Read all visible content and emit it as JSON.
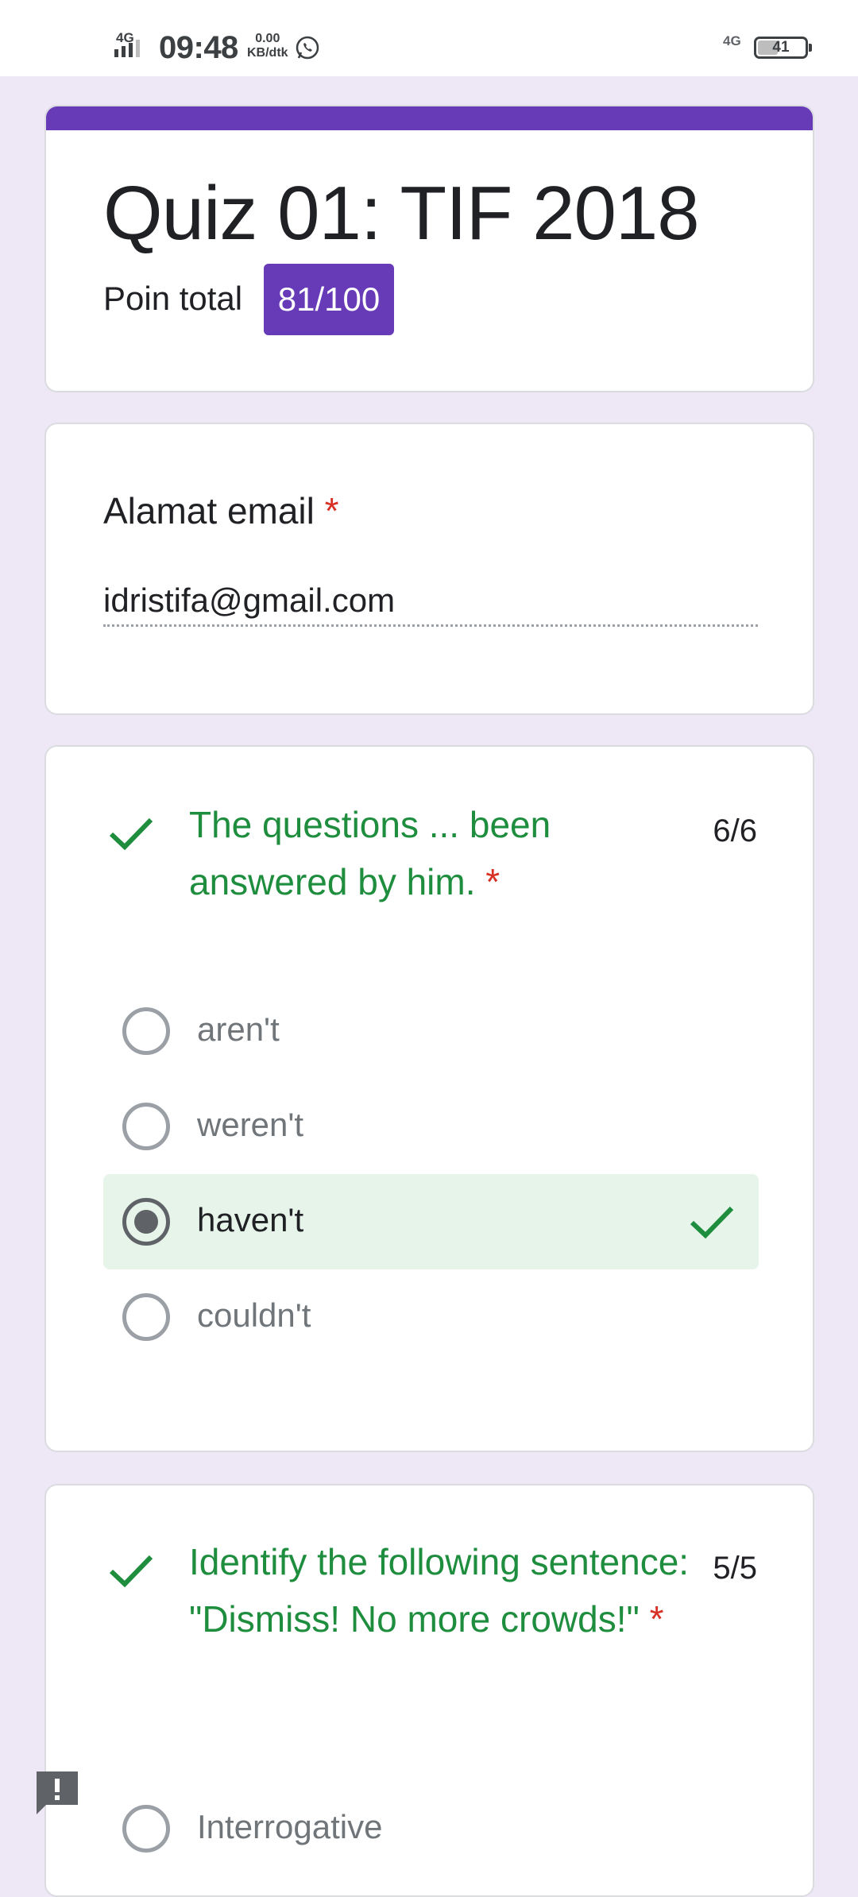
{
  "status_bar": {
    "network_left": "4G",
    "time": "09:48",
    "speed_value": "0.00",
    "speed_unit": "KB/dtk",
    "network_right": "4G",
    "battery_level": "41",
    "icons": [
      "signal-icon",
      "whatsapp-icon",
      "battery-icon"
    ]
  },
  "quiz": {
    "title": "Quiz 01: TIF 2018",
    "points_label": "Poin total",
    "points_value": "81/100",
    "accent_color": "#673ab7"
  },
  "email": {
    "label": "Alamat email",
    "required_mark": "*",
    "value": "idristifa@gmail.com"
  },
  "questions": [
    {
      "text": "The questions ... been answered by him.",
      "required_mark": "*",
      "score": "6/6",
      "correct": true,
      "options": [
        {
          "label": "aren't",
          "selected": false
        },
        {
          "label": "weren't",
          "selected": false
        },
        {
          "label": "haven't",
          "selected": true,
          "correct": true
        },
        {
          "label": "couldn't",
          "selected": false
        }
      ]
    },
    {
      "text": "Identify the following sentence: \"Dismiss! No more crowds!\"",
      "required_mark": "*",
      "score": "5/5",
      "correct": true,
      "options": [
        {
          "label": "Interrogative",
          "selected": false
        }
      ]
    }
  ],
  "colors": {
    "correct_green": "#1e8e3e",
    "correct_bg": "#e6f4ea",
    "required_red": "#d93025",
    "page_bg": "#ede7f6"
  }
}
